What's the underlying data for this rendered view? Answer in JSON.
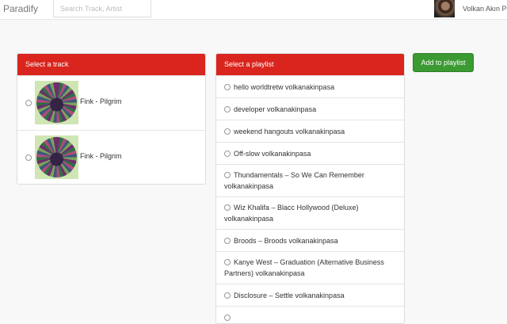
{
  "navbar": {
    "brand": "Paradify",
    "search_placeholder": "Search Track, Artist",
    "username": "Volkan Akın P"
  },
  "tracks_panel": {
    "heading": "Select a track",
    "tracks": [
      {
        "title": "Fink - Pilgrim"
      },
      {
        "title": "Fink - Pilgrim"
      }
    ]
  },
  "playlists_panel": {
    "heading": "Select a playlist",
    "playlists": [
      {
        "name": "hello worldtretw volkanakinpasa"
      },
      {
        "name": "developer volkanakinpasa"
      },
      {
        "name": "weekend hangouts volkanakinpasa"
      },
      {
        "name": "Off-slow volkanakinpasa"
      },
      {
        "name": "Thundamentals – So We Can Remember volkanakinpasa"
      },
      {
        "name": "Wiz Khalifa – Blacc Hollywood (Deluxe) volkanakinpasa"
      },
      {
        "name": "Broods – Broods volkanakinpasa"
      },
      {
        "name": "Kanye West – Graduation (Alternative Business Partners) volkanakinpasa"
      },
      {
        "name": "Disclosure – Settle volkanakinpasa"
      }
    ]
  },
  "actions": {
    "add_label": "Add to playlist"
  },
  "colors": {
    "heading_red": "#d9251d",
    "button_green": "#3c9a33"
  }
}
